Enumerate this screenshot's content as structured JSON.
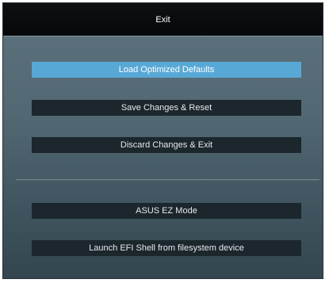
{
  "dialog": {
    "title": "Exit"
  },
  "menu": {
    "items": [
      {
        "label": "Load Optimized Defaults",
        "selected": true
      },
      {
        "label": "Save Changes & Reset",
        "selected": false
      },
      {
        "label": "Discard Changes & Exit",
        "selected": false
      },
      {
        "label": "ASUS EZ Mode",
        "selected": false
      },
      {
        "label": "Launch EFI Shell from filesystem device",
        "selected": false
      }
    ]
  },
  "colors": {
    "selected": "#58a8d6",
    "button": "#1c262d",
    "titlebar": "#05080a"
  }
}
